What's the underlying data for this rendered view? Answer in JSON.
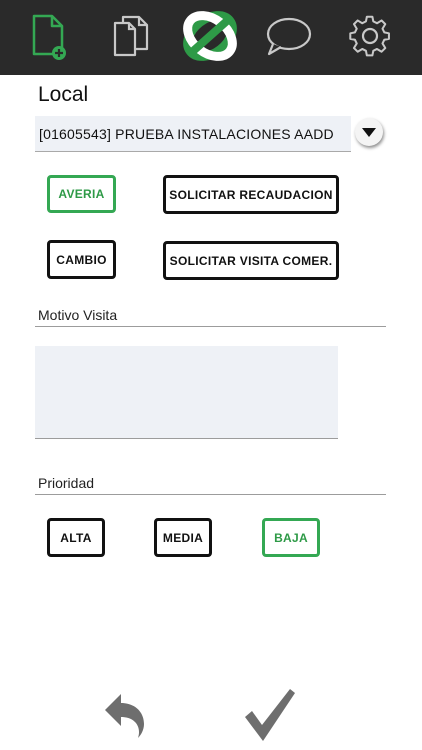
{
  "toolbar": {
    "icons": [
      "new-document-icon",
      "documents-icon",
      "brand-logo-icon",
      "chat-icon",
      "settings-icon"
    ]
  },
  "local": {
    "title": "Local",
    "selected_value": "[01605543] PRUEBA INSTALACIONES AADD"
  },
  "visit_types": {
    "averia": "AVERIA",
    "solicitar_recaudacion": "SOLICITAR RECAUDACION",
    "cambio": "CAMBIO",
    "solicitar_visita": "SOLICITAR VISITA COMER."
  },
  "motivo": {
    "label": "Motivo Visita",
    "value": ""
  },
  "priority": {
    "label": "Prioridad",
    "alta": "ALTA",
    "media": "MEDIA",
    "baja": "BAJA",
    "selected": "BAJA"
  },
  "colors": {
    "topbar": "#2a2a2a",
    "accent_green": "#34a853",
    "field_bg": "#eef1f6",
    "icon_gray": "#6e6e6e"
  },
  "footer": {
    "icons": [
      "undo-icon",
      "confirm-checkmark-icon"
    ]
  }
}
